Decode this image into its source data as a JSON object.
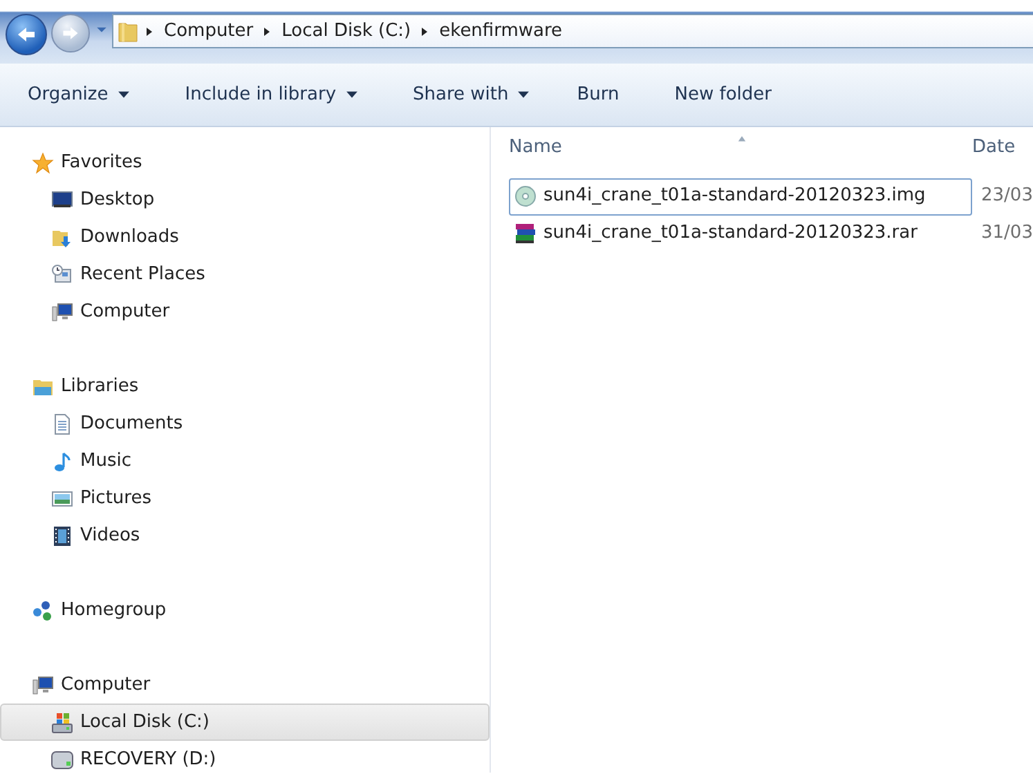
{
  "address_bar": {
    "segments": [
      "Computer",
      "Local Disk (C:)",
      "ekenfirmware"
    ]
  },
  "toolbar": [
    {
      "label": "Organize",
      "has_menu": true
    },
    {
      "label": "Include in library",
      "has_menu": true
    },
    {
      "label": "Share with",
      "has_menu": true
    },
    {
      "label": "Burn",
      "has_menu": false
    },
    {
      "label": "New folder",
      "has_menu": false
    }
  ],
  "navigation": [
    {
      "header": "Favorites",
      "items": [
        {
          "label": "Desktop",
          "selected": false
        },
        {
          "label": "Downloads",
          "selected": false
        },
        {
          "label": "Recent Places",
          "selected": false
        },
        {
          "label": "Computer",
          "selected": false
        }
      ]
    },
    {
      "header": "Libraries",
      "items": [
        {
          "label": "Documents",
          "selected": false
        },
        {
          "label": "Music",
          "selected": false
        },
        {
          "label": "Pictures",
          "selected": false
        },
        {
          "label": "Videos",
          "selected": false
        }
      ]
    },
    {
      "header": "Homegroup"
    },
    {
      "header": "Computer",
      "items": [
        {
          "label": "Local Disk (C:)",
          "selected": true
        },
        {
          "label": "RECOVERY (D:)",
          "selected": false
        }
      ]
    }
  ],
  "file_list": {
    "columns": [
      {
        "label": "Name",
        "sorted": true
      },
      {
        "label": "Date",
        "sorted": false
      }
    ],
    "rows": [
      {
        "kind": "disc-image",
        "name": "sun4i_crane_t01a-standard-20120323.img",
        "date": "23/03",
        "selected": true
      },
      {
        "kind": "archive",
        "name": "sun4i_crane_t01a-standard-20120323.rar",
        "date": "31/03",
        "selected": false
      }
    ]
  }
}
